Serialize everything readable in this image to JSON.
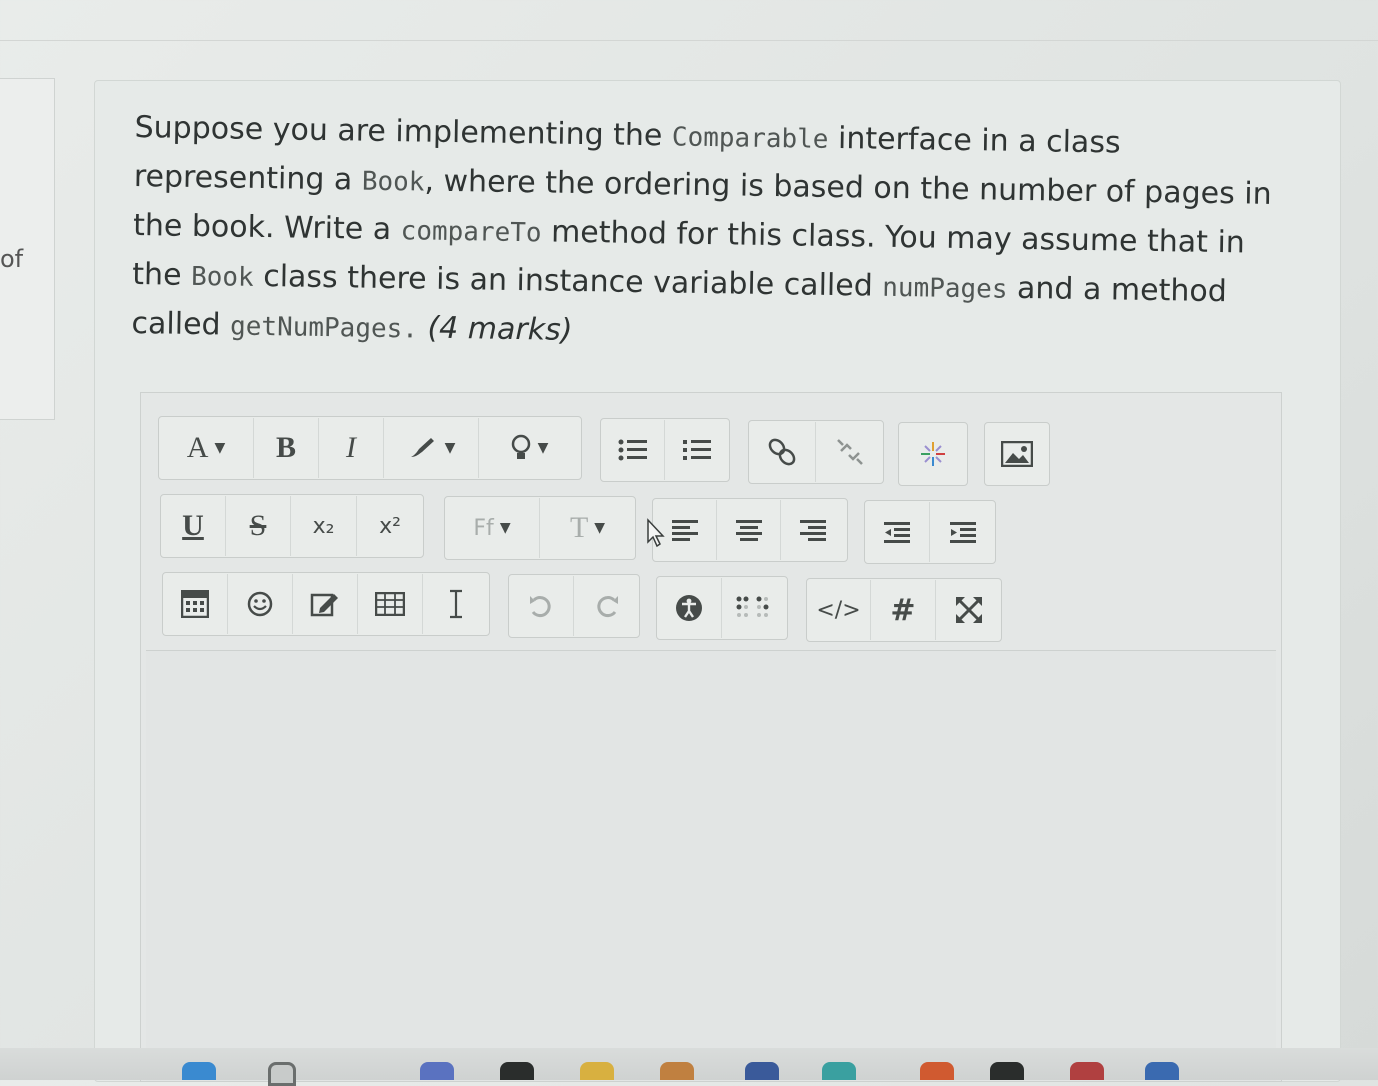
{
  "left_fragment": "of",
  "question": {
    "t1": "Suppose you are implementing the ",
    "c1": "Comparable",
    "t2": " interface in a class representing a ",
    "c2": "Book",
    "t3": ", where the ordering is based on the number of pages in the book. Write a ",
    "c3": "compareTo",
    "t4": " method for this class. You may assume that in the ",
    "c4": "Book",
    "t5": " class there is an instance variable called ",
    "c5": "numPages",
    "t6": " and a method called ",
    "c6": "getNumPages.",
    "t7": " (4 marks)"
  },
  "toolbar": {
    "font_color": "A",
    "bold": "B",
    "italic": "I",
    "underline": "U",
    "strike": "S",
    "subscript": "x₂",
    "superscript": "x²",
    "font_family": "Ff",
    "font_size": "T",
    "html_tag": "</>",
    "hash": "#"
  },
  "colors": {
    "background": "#e6eae8",
    "text": "#2f3433",
    "icon": "#464b49"
  }
}
